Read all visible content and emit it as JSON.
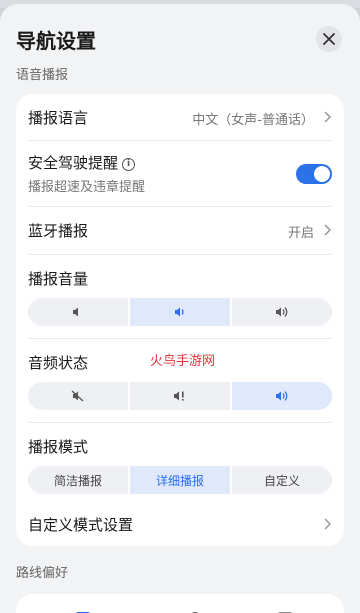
{
  "header": {
    "title": "导航设置"
  },
  "sections": {
    "voice": "语音播报",
    "route": "路线偏好"
  },
  "rows": {
    "language": {
      "label": "播报语言",
      "value": "中文（女声-普通话）"
    },
    "safety": {
      "label": "安全驾驶提醒",
      "sub": "播报超速及违章提醒",
      "info": "i",
      "toggle_on": true
    },
    "bluetooth": {
      "label": "蓝牙播报",
      "value": "开启"
    },
    "volume": {
      "label": "播报音量",
      "options": [
        "low-volume-icon",
        "medium-volume-icon",
        "high-volume-icon"
      ],
      "selected": 1
    },
    "audio_state": {
      "label": "音频状态",
      "options": [
        "mute-icon",
        "alert-volume-icon",
        "sound-on-icon"
      ],
      "selected": 2
    },
    "mode": {
      "label": "播报模式",
      "options": [
        "简洁播报",
        "详细播报",
        "自定义"
      ],
      "selected": 1
    },
    "custom": {
      "label": "自定义模式设置"
    }
  },
  "watermark": "火鸟手游网",
  "colors": {
    "accent": "#2b71e8",
    "accent_light": "#dfe9fb",
    "watermark": "#e0343a"
  }
}
